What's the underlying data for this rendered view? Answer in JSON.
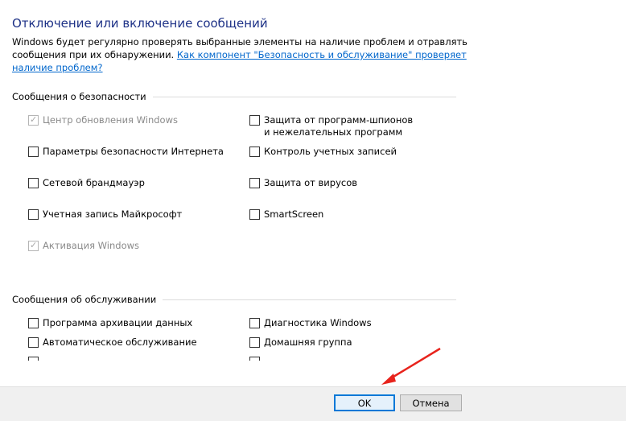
{
  "title": "Отключение или включение сообщений",
  "description": {
    "text": "Windows будет регулярно проверять выбранные элементы на наличие проблем и отравлять сообщения при их обнаружении. ",
    "link": "Как компонент \"Безопасность и обслуживание\" проверяет наличие проблем?"
  },
  "security": {
    "heading": "Сообщения о безопасности",
    "items": [
      {
        "label": "Центр обновления Windows",
        "checked": true,
        "disabled": true
      },
      {
        "label": "Защита от программ-шпионов и нежелательных программ",
        "checked": false,
        "disabled": false
      },
      {
        "label": "Параметры безопасности Интернета",
        "checked": false,
        "disabled": false
      },
      {
        "label": "Контроль учетных записей",
        "checked": false,
        "disabled": false
      },
      {
        "label": "Сетевой брандмауэр",
        "checked": false,
        "disabled": false
      },
      {
        "label": "Защита от вирусов",
        "checked": false,
        "disabled": false
      },
      {
        "label": "Учетная запись Майкрософт",
        "checked": false,
        "disabled": false
      },
      {
        "label": "SmartScreen",
        "checked": false,
        "disabled": false
      },
      {
        "label": "Активация Windows",
        "checked": true,
        "disabled": true
      }
    ]
  },
  "maintenance": {
    "heading": "Сообщения об обслуживании",
    "items": [
      {
        "label": "Программа архивации данных",
        "checked": false
      },
      {
        "label": "Диагностика Windows",
        "checked": false
      },
      {
        "label": "Автоматическое обслуживание",
        "checked": false
      },
      {
        "label": "Домашняя группа",
        "checked": false
      }
    ]
  },
  "buttons": {
    "ok": "OK",
    "cancel": "Отмена"
  },
  "colors": {
    "title": "#1e3287",
    "link": "#0066cc",
    "arrow": "#e8231c",
    "ok_border": "#0078d7"
  }
}
